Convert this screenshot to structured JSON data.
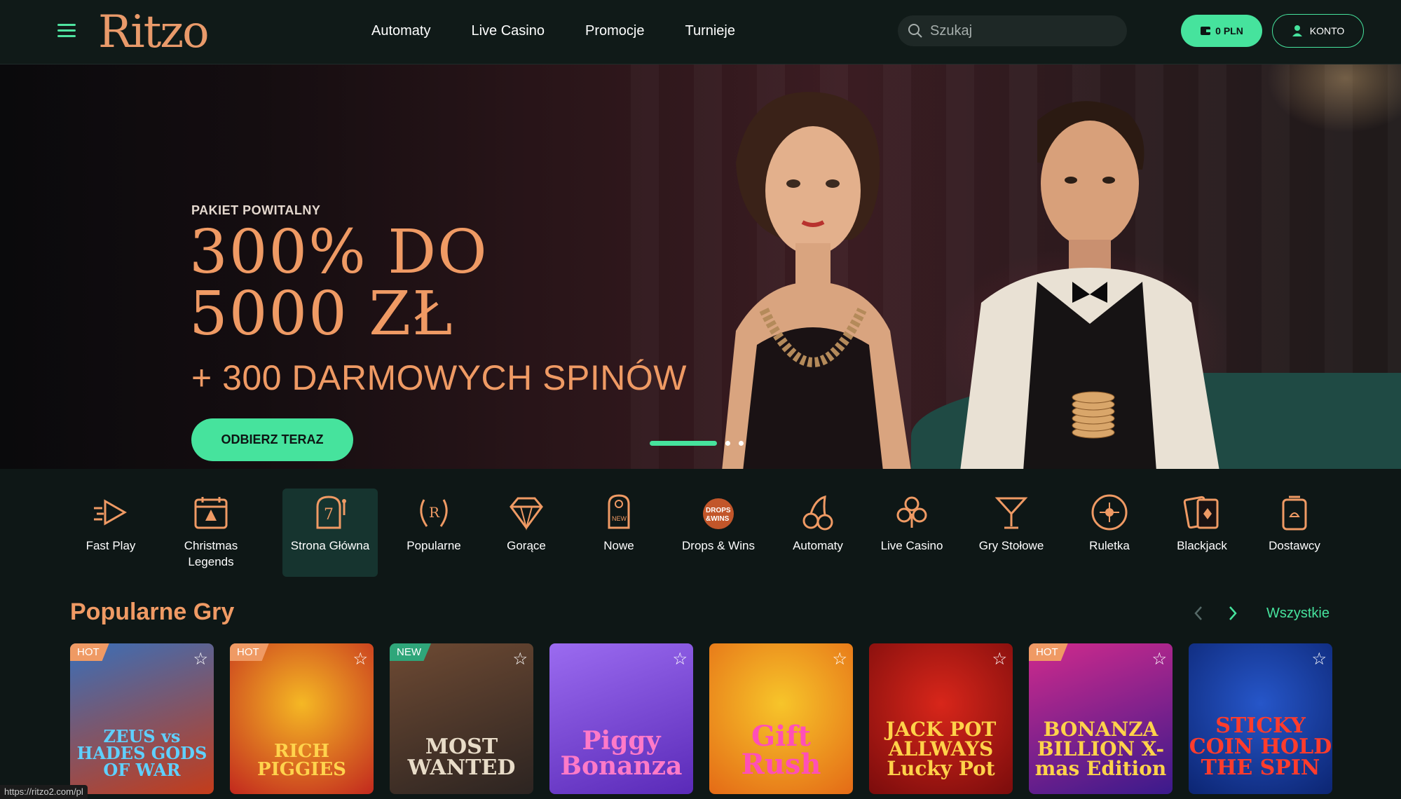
{
  "header": {
    "logo": "Ritzo",
    "nav": [
      "Automaty",
      "Live Casino",
      "Promocje",
      "Turnieje"
    ],
    "search_placeholder": "Szukaj",
    "balance": "0 PLN",
    "account": "KONTO"
  },
  "hero": {
    "eyebrow": "PAKIET POWITALNY",
    "title_line1": "300% DO",
    "title_line2": "5000 ZŁ",
    "subtitle": "+ 300 DARMOWYCH SPINÓW",
    "cta": "ODBIERZ TERAZ",
    "slides_total": 3,
    "slide_active": 1
  },
  "categories": [
    {
      "label": "Fast Play",
      "icon": "fast-play-icon"
    },
    {
      "label": "Christmas Legends",
      "icon": "calendar-tree-icon"
    },
    {
      "label": "Strona Główna",
      "icon": "slot-machine-icon",
      "active": true
    },
    {
      "label": "Popularne",
      "icon": "laurel-icon"
    },
    {
      "label": "Gorące",
      "icon": "diamond-icon"
    },
    {
      "label": "Nowe",
      "icon": "door-hanger-icon"
    },
    {
      "label": "Drops & Wins",
      "icon": "drops-wins-icon"
    },
    {
      "label": "Automaty",
      "icon": "cherries-icon"
    },
    {
      "label": "Live Casino",
      "icon": "club-icon"
    },
    {
      "label": "Gry Stołowe",
      "icon": "cocktail-icon"
    },
    {
      "label": "Ruletka",
      "icon": "roulette-icon"
    },
    {
      "label": "Blackjack",
      "icon": "cards-icon"
    },
    {
      "label": "Dostawcy",
      "icon": "provider-icon"
    }
  ],
  "popular": {
    "title": "Popularne Gry",
    "see_all": "Wszystkie",
    "games": [
      {
        "title": "ZEUS vs HADES GODS OF WAR",
        "badge": "HOT",
        "bg1": "#3a6fb8",
        "bg2": "#c43c1a",
        "color": "#5fd0ff"
      },
      {
        "title": "RICH PIGGIES",
        "badge": "HOT",
        "bg1": "#f5b824",
        "bg2": "#c2281e",
        "color": "#ffd34d"
      },
      {
        "title": "MOST WANTED",
        "badge": "NEW",
        "bg1": "#6e4a33",
        "bg2": "#2c2421",
        "color": "#e8dcc8"
      },
      {
        "title": "Piggy Bonanza",
        "badge": "",
        "bg1": "#9b6bf0",
        "bg2": "#5a2ab8",
        "color": "#ff7ac8"
      },
      {
        "title": "Gift Rush",
        "badge": "",
        "bg1": "#f7c52a",
        "bg2": "#e46a16",
        "color": "#ff4fb8"
      },
      {
        "title": "JACK POT ALLWAYS Lucky Pot",
        "badge": "",
        "bg1": "#d8261a",
        "bg2": "#7a0c0c",
        "color": "#ffd24a"
      },
      {
        "title": "BONANZA BILLION X-mas Edition",
        "badge": "HOT",
        "bg1": "#d02a8c",
        "bg2": "#3a1a8c",
        "color": "#ffd24a"
      },
      {
        "title": "STICKY COIN HOLD THE SPIN",
        "badge": "",
        "bg1": "#2656c9",
        "bg2": "#0c2572",
        "color": "#ff3c2c"
      }
    ]
  },
  "status_url": "https://ritzo2.com/pl",
  "colors": {
    "accent_green": "#46e39d",
    "accent_orange": "#ef9a64",
    "background": "#0e1716"
  }
}
